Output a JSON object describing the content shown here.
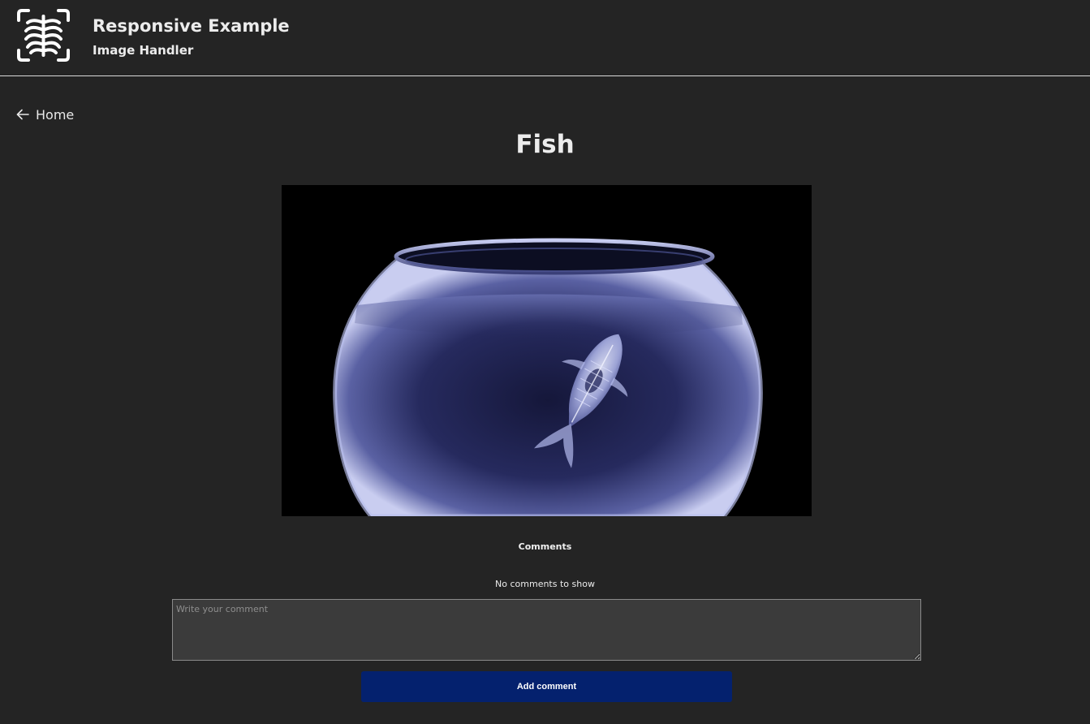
{
  "header": {
    "logo_icon": "xray-ribcage-icon",
    "title": "Responsive Example",
    "subtitle": "Image Handler"
  },
  "nav": {
    "back_icon": "arrow-left-icon",
    "back_label": "Home"
  },
  "page": {
    "title": "Fish"
  },
  "comments": {
    "heading": "Comments",
    "empty_message": "No comments to show",
    "input_placeholder": "Write your comment",
    "input_value": "",
    "submit_label": "Add comment"
  },
  "colors": {
    "background": "#242424",
    "button": "#04216e",
    "input_background": "#3b3b3b"
  }
}
